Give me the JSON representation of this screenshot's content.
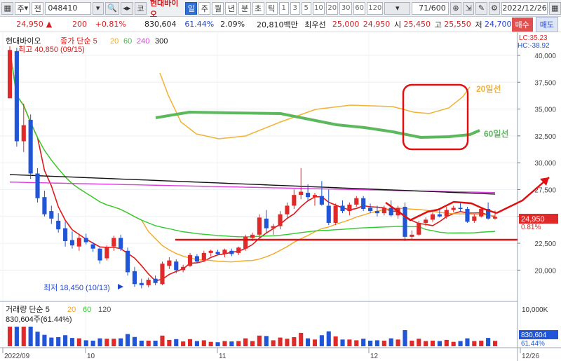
{
  "toolbar": {
    "type_label": "주",
    "period_label": "전",
    "code": "048410",
    "corp_mark": "코",
    "name": "현대바이오",
    "tabs": [
      "일",
      "주",
      "월",
      "년",
      "분",
      "초",
      "틱"
    ],
    "nums": [
      "1",
      "3",
      "5",
      "10",
      "20",
      "30",
      "60",
      "120"
    ],
    "count": "71/600",
    "date": "2022/12/26"
  },
  "quote": {
    "price": "24,950",
    "arrow": "▲",
    "change": "200",
    "pct": "+0.81%",
    "volume": "830,604",
    "vol_ratio": "61.44%",
    "turnover": "2.09%",
    "amount": "20,810백만",
    "best_label": "최우선",
    "best_sell": "25,000",
    "best_buy": "24,950",
    "open_label": "시",
    "open": "25,450",
    "high_label": "고",
    "high": "25,550",
    "low_label": "저",
    "low": "24,700",
    "buy_btn": "매수",
    "sell_btn": "매도"
  },
  "legend": {
    "name": "현대바이오",
    "ma_label": "종가 단순 5",
    "ma20": "20",
    "ma60": "60",
    "ma240": "240",
    "ma300": "300",
    "hi_label": "최고 40,850 (09/15)",
    "lo_label": "최저 18,450 (10/13)",
    "lc": "LC:35.23",
    "hc": "HC:-38.92",
    "price_tag": "24,950",
    "pct_tag": "0.81%",
    "ann20": "20일선",
    "ann60": "60일선",
    "vol_label": "거래량 단순 5",
    "vol20": "20",
    "vol60": "60",
    "vol120": "120",
    "vol_value": "830,604주(61.44%)",
    "vol_axis": "10,000K",
    "vol_tag": "830,604",
    "vol_pct": "61.44%"
  },
  "colors": {
    "up": "#e02a2a",
    "down": "#1f55d6",
    "ma5": "#e01818",
    "ma20": "#f5a623",
    "ma60": "#2ecc2e",
    "ma240": "#e13ae1",
    "ma300": "#111111",
    "ann20": "#f2b233",
    "ann60": "#5cb85c"
  },
  "chart_data": {
    "type": "candlestick",
    "y_ticks": [
      "40,000",
      "37,500",
      "35,000",
      "32,500",
      "30,000",
      "27,500",
      "25,000",
      "22,500",
      "20,000"
    ],
    "y_range": [
      18000,
      41500
    ],
    "x_labels": [
      "2022/09",
      "10",
      "11",
      "12",
      "12/26"
    ],
    "support_line": 23000,
    "candles": [
      [
        36000,
        40850,
        36000,
        40500
      ],
      [
        40400,
        40700,
        31500,
        32000
      ],
      [
        32000,
        35500,
        31000,
        33500
      ],
      [
        34000,
        34500,
        28500,
        29000
      ],
      [
        29000,
        29500,
        26300,
        26700
      ],
      [
        26800,
        27400,
        25000,
        25200
      ],
      [
        25500,
        26000,
        24300,
        24800
      ],
      [
        24600,
        25300,
        23500,
        23800
      ],
      [
        23900,
        24500,
        22200,
        22700
      ],
      [
        22800,
        23600,
        22000,
        22300
      ],
      [
        22200,
        23300,
        21800,
        23000
      ],
      [
        23000,
        23400,
        22400,
        22600
      ],
      [
        22400,
        22600,
        21700,
        22000
      ],
      [
        22000,
        22100,
        20600,
        20900
      ],
      [
        21100,
        22300,
        20900,
        22100
      ],
      [
        22200,
        23200,
        21800,
        23000
      ],
      [
        23000,
        23300,
        21800,
        22000
      ],
      [
        21800,
        22100,
        19500,
        19800
      ],
      [
        19900,
        20300,
        18450,
        18700
      ],
      [
        18800,
        19200,
        18300,
        18600
      ],
      [
        18600,
        19300,
        18400,
        19100
      ],
      [
        19200,
        19500,
        18600,
        18800
      ],
      [
        18700,
        20800,
        18600,
        20600
      ],
      [
        20400,
        21200,
        20100,
        20900
      ],
      [
        20800,
        21000,
        19700,
        20000
      ],
      [
        20000,
        20500,
        19800,
        20300
      ],
      [
        20400,
        21600,
        20300,
        21400
      ],
      [
        21300,
        21500,
        20700,
        20800
      ],
      [
        20900,
        21800,
        20800,
        21600
      ],
      [
        21600,
        21900,
        21300,
        21800
      ],
      [
        21700,
        21900,
        21400,
        21500
      ],
      [
        21500,
        22000,
        21200,
        21900
      ],
      [
        21800,
        22000,
        21300,
        21500
      ],
      [
        21600,
        22200,
        21400,
        22100
      ],
      [
        22000,
        23300,
        21800,
        23100
      ],
      [
        23000,
        23500,
        22700,
        23300
      ],
      [
        23300,
        25200,
        23000,
        24900
      ],
      [
        24800,
        25600,
        23500,
        23900
      ],
      [
        23900,
        24300,
        23300,
        24100
      ],
      [
        24100,
        25500,
        23800,
        25200
      ],
      [
        25200,
        26300,
        24900,
        26000
      ],
      [
        26000,
        27500,
        25700,
        27000
      ],
      [
        27000,
        29500,
        26600,
        27300
      ],
      [
        27200,
        28000,
        26500,
        26800
      ],
      [
        26800,
        27200,
        26000,
        27000
      ],
      [
        26900,
        28300,
        26000,
        26100
      ],
      [
        26000,
        27500,
        24200,
        24400
      ],
      [
        24400,
        26200,
        24200,
        26000
      ],
      [
        26000,
        26500,
        25300,
        25500
      ],
      [
        25500,
        26300,
        25100,
        26100
      ],
      [
        26100,
        26900,
        25900,
        26700
      ],
      [
        26700,
        26900,
        25500,
        25700
      ],
      [
        25800,
        26200,
        25300,
        25500
      ],
      [
        25500,
        26000,
        25000,
        25300
      ],
      [
        25300,
        26000,
        25100,
        25800
      ],
      [
        25800,
        26500,
        25000,
        25100
      ],
      [
        25100,
        26000,
        24800,
        25800
      ],
      [
        25900,
        26300,
        22700,
        23100
      ],
      [
        23100,
        23700,
        22800,
        23300
      ],
      [
        23300,
        24600,
        23200,
        24400
      ],
      [
        24400,
        24900,
        24100,
        24700
      ],
      [
        24700,
        25400,
        24500,
        25200
      ],
      [
        25200,
        25700,
        24900,
        25000
      ],
      [
        25000,
        25900,
        24800,
        25600
      ],
      [
        25600,
        26000,
        25400,
        25800
      ],
      [
        25800,
        26300,
        25500,
        25700
      ],
      [
        25700,
        25900,
        24400,
        24500
      ],
      [
        24600,
        25200,
        24400,
        25000
      ],
      [
        25000,
        25800,
        24900,
        25700
      ],
      [
        25700,
        26300,
        24700,
        24800
      ],
      [
        24800,
        25550,
        24700,
        24950
      ]
    ]
  }
}
